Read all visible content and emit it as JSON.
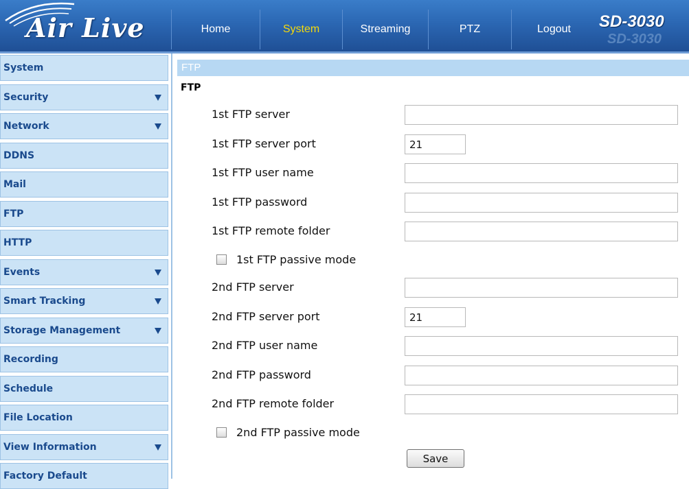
{
  "header": {
    "logo_text": "Air Live",
    "model": "SD-3030",
    "model_ghost": "SD-3030",
    "nav": [
      {
        "label": "Home",
        "active": false
      },
      {
        "label": "System",
        "active": true
      },
      {
        "label": "Streaming",
        "active": false
      },
      {
        "label": "PTZ",
        "active": false
      },
      {
        "label": "Logout",
        "active": false
      }
    ]
  },
  "sidebar": {
    "items": [
      {
        "label": "System",
        "expandable": false
      },
      {
        "label": "Security",
        "expandable": true
      },
      {
        "label": "Network",
        "expandable": true
      },
      {
        "label": "DDNS",
        "expandable": false
      },
      {
        "label": "Mail",
        "expandable": false
      },
      {
        "label": "FTP",
        "expandable": false
      },
      {
        "label": "HTTP",
        "expandable": false
      },
      {
        "label": "Events",
        "expandable": true
      },
      {
        "label": "Smart Tracking",
        "expandable": true
      },
      {
        "label": "Storage Management",
        "expandable": true
      },
      {
        "label": "Recording",
        "expandable": false
      },
      {
        "label": "Schedule",
        "expandable": false
      },
      {
        "label": "File Location",
        "expandable": false
      },
      {
        "label": "View Information",
        "expandable": true
      },
      {
        "label": "Factory Default",
        "expandable": false
      }
    ]
  },
  "main": {
    "section_bar": "FTP",
    "section_title": "FTP",
    "fields": [
      {
        "label": "1st FTP server",
        "value": "",
        "size": "long"
      },
      {
        "label": "1st FTP server port",
        "value": "21",
        "size": "short"
      },
      {
        "label": "1st FTP user name",
        "value": "",
        "size": "long"
      },
      {
        "label": "1st FTP password",
        "value": "",
        "size": "long"
      },
      {
        "label": "1st FTP remote folder",
        "value": "",
        "size": "long"
      },
      {
        "label": "1st FTP passive mode",
        "type": "checkbox",
        "checked": false
      },
      {
        "label": "2nd FTP server",
        "value": "",
        "size": "long"
      },
      {
        "label": "2nd FTP server port",
        "value": "21",
        "size": "short"
      },
      {
        "label": "2nd FTP user name",
        "value": "",
        "size": "long"
      },
      {
        "label": "2nd FTP password",
        "value": "",
        "size": "long"
      },
      {
        "label": "2nd FTP remote folder",
        "value": "",
        "size": "long"
      },
      {
        "label": "2nd FTP passive mode",
        "type": "checkbox",
        "checked": false
      }
    ],
    "save_label": "Save"
  },
  "colors": {
    "header_blue": "#2b67b3",
    "active_nav": "#f5d90a",
    "sidebar_bg": "#cbe3f6",
    "sidebar_text": "#1a4a8d",
    "section_bar": "#b7d8f3"
  }
}
